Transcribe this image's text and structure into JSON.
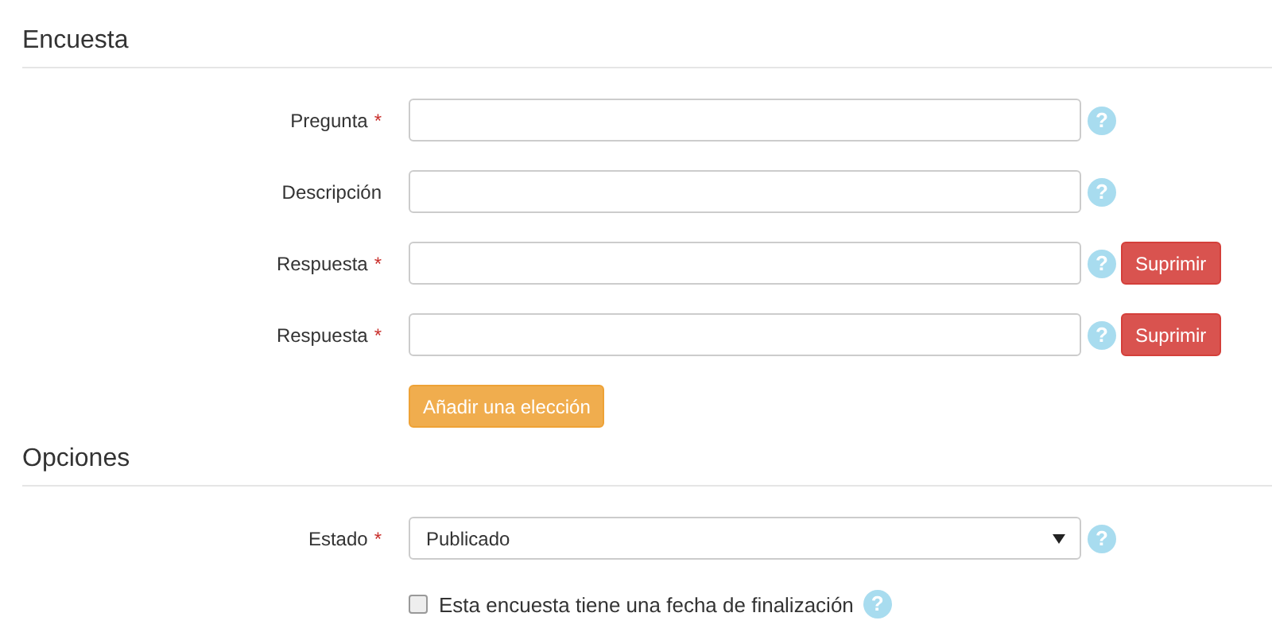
{
  "sections": [
    {
      "title": "Encuesta",
      "fields": [
        {
          "kind": "text",
          "label": "Pregunta",
          "required_mark": "*",
          "help": "?"
        },
        {
          "kind": "text",
          "label": "Descripción",
          "help": "?"
        },
        {
          "kind": "text",
          "label": "Respuesta",
          "required_mark": "*",
          "help": "?",
          "delete_label": "Suprimir"
        },
        {
          "kind": "text",
          "label": "Respuesta",
          "required_mark": "*",
          "help": "?",
          "delete_label": "Suprimir"
        },
        {
          "kind": "button",
          "label": "Añadir una elección"
        }
      ]
    },
    {
      "title": "Opciones",
      "fields": [
        {
          "kind": "select",
          "label": "Estado",
          "required_mark": "*",
          "value": "Publicado",
          "help": "?"
        },
        {
          "kind": "checkbox",
          "label": "Esta encuesta tiene una fecha de finalización",
          "checked": false,
          "help": "?"
        }
      ]
    }
  ]
}
